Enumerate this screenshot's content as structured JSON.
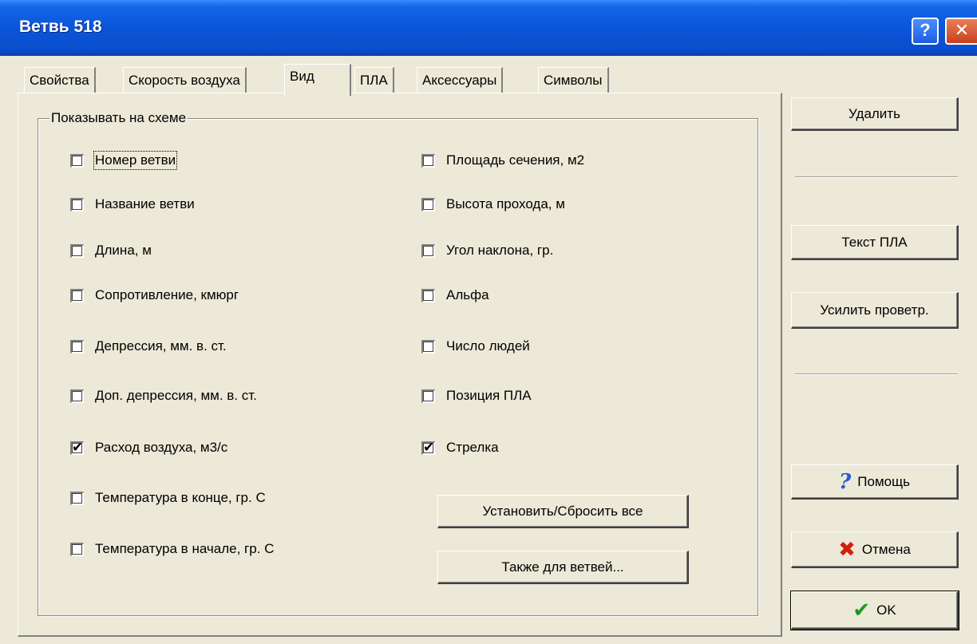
{
  "window": {
    "title": "Ветвь 518"
  },
  "titlebar_buttons": {
    "help": "?",
    "close": "✕"
  },
  "tabs": [
    {
      "label": "Свойства"
    },
    {
      "label": "Скорость воздуха"
    },
    {
      "label": "Вид"
    },
    {
      "label": "ПЛА"
    },
    {
      "label": "Аксессуары"
    },
    {
      "label": "Символы"
    }
  ],
  "active_tab": "Вид",
  "group": {
    "label": "Показывать на схеме"
  },
  "checkboxes_left": [
    {
      "label": "Номер ветви",
      "checked": false
    },
    {
      "label": "Название ветви",
      "checked": false
    },
    {
      "label": "Длина, м",
      "checked": false
    },
    {
      "label": "Сопротивление, кмюрг",
      "checked": false
    },
    {
      "label": "Депрессия, мм. в. ст.",
      "checked": false
    },
    {
      "label": "Доп. депрессия, мм. в. ст.",
      "checked": false
    },
    {
      "label": "Расход воздуха, м3/с",
      "checked": true
    },
    {
      "label": "Температура в конце, гр. С",
      "checked": false
    },
    {
      "label": "Температура в начале, гр. С",
      "checked": false
    }
  ],
  "checkboxes_right": [
    {
      "label": "Площадь сечения, м2",
      "checked": false
    },
    {
      "label": "Высота прохода, м",
      "checked": false
    },
    {
      "label": "Угол наклона, гр.",
      "checked": false
    },
    {
      "label": "Альфа",
      "checked": false
    },
    {
      "label": "Число людей",
      "checked": false
    },
    {
      "label": "Позиция ПЛА",
      "checked": false
    },
    {
      "label": "Стрелка",
      "checked": true
    }
  ],
  "panel_buttons": {
    "set_reset_all": "Установить/Сбросить все",
    "also_for_branches": "Также для ветвей..."
  },
  "side_buttons": {
    "delete": "Удалить",
    "pla_text": "Текст ПЛА",
    "boost_ventilation": "Усилить проветр.",
    "help": "Помощь",
    "cancel": "Отмена",
    "ok": "OK"
  },
  "check_mark": "✔"
}
